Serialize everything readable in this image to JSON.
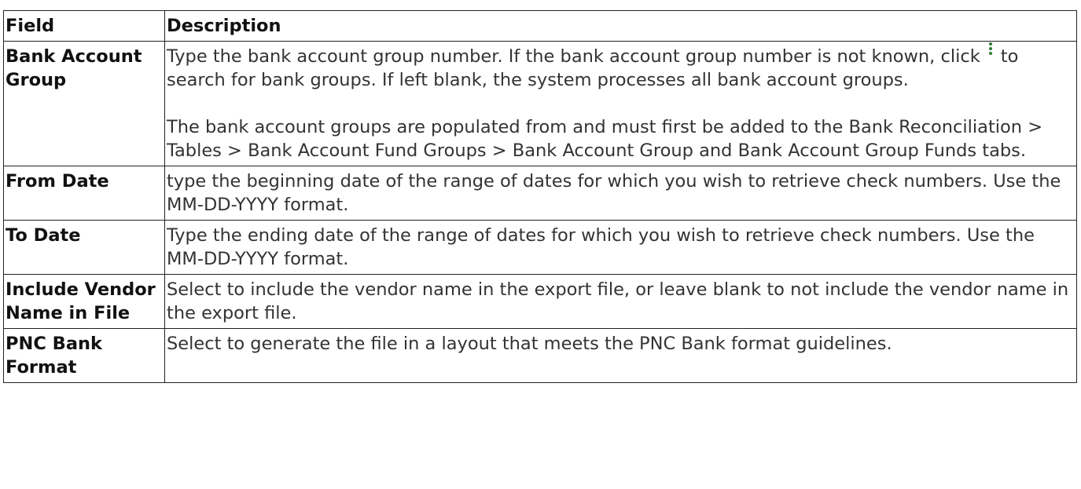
{
  "header": {
    "field": "Field",
    "description": "Description"
  },
  "rows": [
    {
      "field": "Bank Account Group",
      "desc_a": "Type the bank account group number. If the bank account group number is not known, click",
      "icon": "kebab-search-icon",
      "desc_b": "to search for bank groups. If left blank, the system processes all bank account groups.",
      "desc_c": "The bank account groups are populated from and must first be added to the Bank Reconciliation > Tables > Bank Account Fund Groups > Bank Account Group and Bank Account Group Funds tabs."
    },
    {
      "field": "From Date",
      "description": "type the beginning date of the range of dates for which you wish to retrieve check numbers. Use the MM-DD-YYYY format."
    },
    {
      "field": "To Date",
      "description": "Type the ending date of the range of dates for which you wish to retrieve check numbers. Use the MM-DD-YYYY format."
    },
    {
      "field": "Include Vendor Name in File",
      "description": "Select to include the vendor name in the export file, or leave blank to not include the vendor name in the export file."
    },
    {
      "field": "PNC Bank Format",
      "description": "Select to generate the file in a layout that meets the PNC Bank format guidelines."
    }
  ],
  "colors": {
    "icon": "#2e7d32",
    "border": "#222222"
  }
}
